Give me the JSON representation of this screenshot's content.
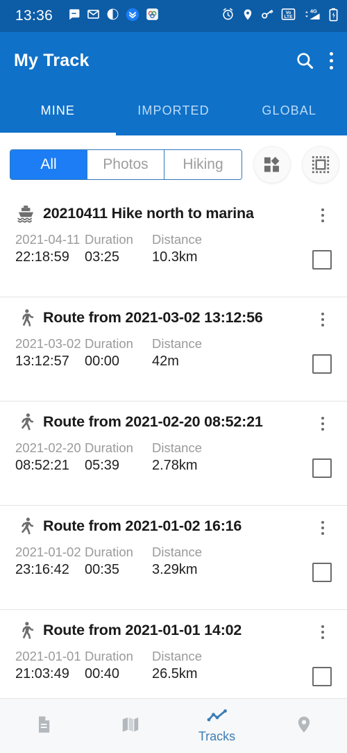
{
  "status_bar": {
    "time": "13:36",
    "left_icons": [
      "chat-bubble-icon",
      "email-icon",
      "circle-contrast-icon",
      "double-chevron-down-icon",
      "app-badge-icon"
    ],
    "right_icons": [
      "alarm-icon",
      "location-pin-icon",
      "vpn-key-icon",
      "volte-icon",
      "signal-4g-icon",
      "battery-icon"
    ],
    "network_label": "4G",
    "volte_label_top": "Vo",
    "volte_label_bottom": "LTE"
  },
  "app_bar": {
    "title": "My Track",
    "search_icon": "search-icon",
    "overflow_icon": "more-vertical-icon"
  },
  "tabs": [
    {
      "label": "MINE",
      "active": true
    },
    {
      "label": "IMPORTED",
      "active": false
    },
    {
      "label": "GLOBAL",
      "active": false
    }
  ],
  "filter_bar": {
    "segments": [
      {
        "label": "All",
        "active": true
      },
      {
        "label": "Photos",
        "active": false
      },
      {
        "label": "Hiking",
        "active": false
      }
    ],
    "buttons": [
      {
        "name": "shapes-layers-icon"
      },
      {
        "name": "selection-frame-icon"
      }
    ]
  },
  "list": {
    "labels": {
      "duration": "Duration",
      "distance": "Distance"
    },
    "items": [
      {
        "icon": "ferry-boat-icon",
        "title": "20210411 Hike north to marina",
        "date": "2021-04-11",
        "time": "22:18:59",
        "duration": "03:25",
        "distance": "10.3km"
      },
      {
        "icon": "walking-person-icon",
        "title": "Route from 2021-03-02 13:12:56",
        "date": "2021-03-02",
        "time": "13:12:57",
        "duration": "00:00",
        "distance": "42m"
      },
      {
        "icon": "running-person-icon",
        "title": "Route from 2021-02-20 08:52:21",
        "date": "2021-02-20",
        "time": "08:52:21",
        "duration": "05:39",
        "distance": "2.78km"
      },
      {
        "icon": "running-person-icon",
        "title": "Route from 2021-01-02 16:16",
        "date": "2021-01-02",
        "time": "23:16:42",
        "duration": "00:35",
        "distance": "3.29km"
      },
      {
        "icon": "walking-person-icon",
        "title": "Route from 2021-01-01 14:02",
        "date": "2021-01-01",
        "time": "21:03:49",
        "duration": "00:40",
        "distance": "26.5km"
      }
    ]
  },
  "bottom_nav": [
    {
      "icon": "document-icon",
      "label": "",
      "active": false
    },
    {
      "icon": "map-icon",
      "label": "",
      "active": false
    },
    {
      "icon": "track-chart-icon",
      "label": "Tracks",
      "active": true
    },
    {
      "icon": "location-pin-icon",
      "label": "",
      "active": false
    }
  ],
  "colors": {
    "status_bar": "#0d5ca6",
    "app_bar": "#1071c8",
    "accent_chip": "#1c7df5",
    "nav_active": "#3c7db5"
  }
}
